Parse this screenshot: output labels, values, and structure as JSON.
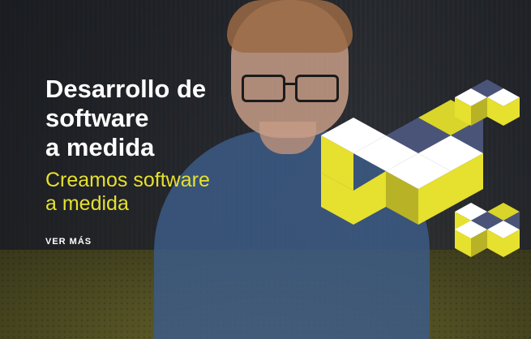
{
  "hero": {
    "title_lines": [
      "Desarrollo de",
      "software",
      "a medida"
    ],
    "subtitle_lines": [
      "Creamos software",
      "a medida"
    ],
    "cta_label": "VER MÁS"
  },
  "colors": {
    "accent_yellow": "#e6e02e",
    "cube_white": "#ffffff",
    "cube_navy": "#4a5479",
    "cube_yellow": "#e6e02e",
    "cube_yellow_shade": "#b8b326"
  },
  "icons": {
    "decoration": "isometric-cubes-icon"
  }
}
